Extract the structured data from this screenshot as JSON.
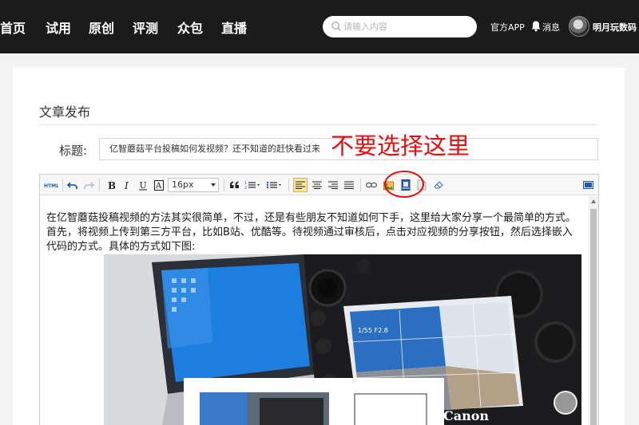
{
  "nav": {
    "items": [
      "首页",
      "试用",
      "原创",
      "评测",
      "众包",
      "直播"
    ],
    "search_placeholder": "请输入内容",
    "app_link": "官方APP",
    "messages": "消息",
    "username": "明月玩数码"
  },
  "page": {
    "section_title": "文章发布",
    "title_label": "标题:",
    "title_value": "亿智蘑菇平台投稿如何发视频？还不知道的赶快看过来"
  },
  "annotation": {
    "text": "不要选择这里",
    "color": "#e01010"
  },
  "toolbar": {
    "font_size": "16px",
    "buttons": [
      "html-source",
      "undo",
      "redo",
      "bold",
      "italic",
      "underline",
      "font-color",
      "font-size",
      "blockquote",
      "ordered-list",
      "unordered-list",
      "align-left",
      "align-center",
      "align-right",
      "justify",
      "link",
      "insert-image",
      "insert-video",
      "insert-file",
      "eraser",
      "fullscreen"
    ]
  },
  "content": {
    "paragraph": "在亿智蘑菇投稿视频的方法其实很简单，不过，还是有些朋友不知道如何下手，这里给大家分享一个最简单的方式。首先，将视频上传到第三方平台，比如B站、优酷等。待视频通过审核后，点击对应视频的分享按钮，然后选择嵌入代码的方式。具体的方式如下图:",
    "camera_brand": "Canon",
    "camera_screen_text": "1/55  F2.8"
  }
}
